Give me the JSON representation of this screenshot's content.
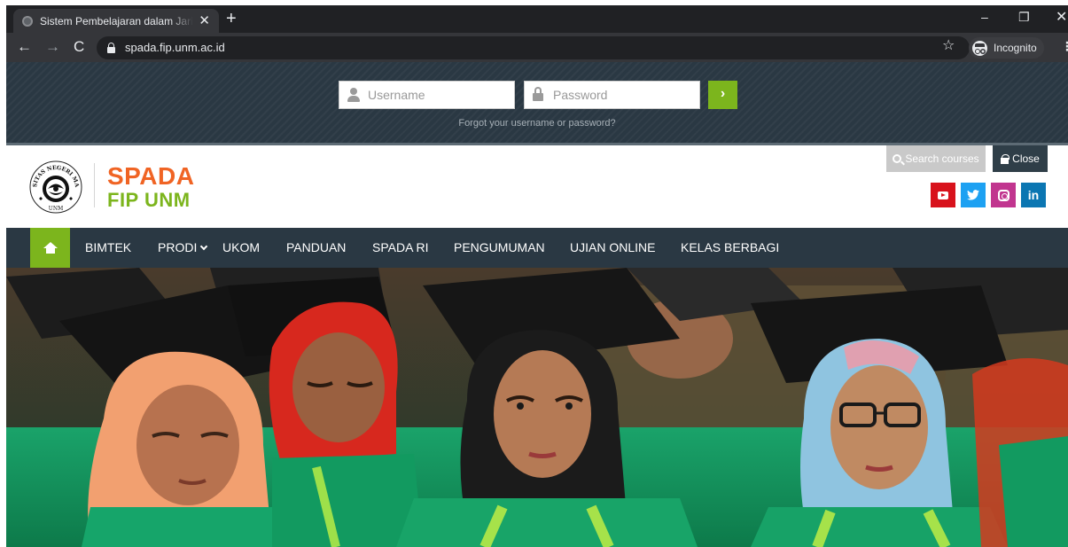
{
  "browser": {
    "tab_title": "Sistem Pembelajaran dalam Jaringan",
    "tab_close": "✕",
    "new_tab": "+",
    "url": "spada.fip.unm.ac.id",
    "incognito_label": "Incognito",
    "window_controls": {
      "minimize": "–",
      "maximize": "❐",
      "close": "✕"
    },
    "nav": {
      "back": "←",
      "forward": "→",
      "reload": "C"
    },
    "star": "☆",
    "menu": "⋮"
  },
  "login": {
    "username_placeholder": "Username",
    "password_placeholder": "Password",
    "submit": "›",
    "forgot": "Forgot your username or password?"
  },
  "header": {
    "brand_line1": "SPADA",
    "brand_line2": "FIP UNM",
    "seal_text_top": "UNIVERSITAS NEGERI MAKASSAR",
    "seal_text_bottom": "UNM",
    "search_label": "Search courses",
    "close_label": "Close",
    "socials": [
      {
        "name": "youtube",
        "glyph": ""
      },
      {
        "name": "twitter",
        "glyph": "🐦"
      },
      {
        "name": "instagram",
        "glyph": ""
      },
      {
        "name": "linkedin",
        "glyph": "in"
      }
    ]
  },
  "nav": {
    "items": [
      {
        "label": "BIMTEK"
      },
      {
        "label": "PRODI"
      },
      {
        "label": "UKOM"
      },
      {
        "label": "PANDUAN"
      },
      {
        "label": "SPADA RI"
      },
      {
        "label": "PENGUMUMAN"
      },
      {
        "label": "UJIAN ONLINE"
      },
      {
        "label": "KELAS BERBAGI"
      }
    ]
  },
  "colors": {
    "accent_green": "#7cb51d",
    "brand_orange": "#f06424",
    "dark_navy": "#2a3843"
  }
}
